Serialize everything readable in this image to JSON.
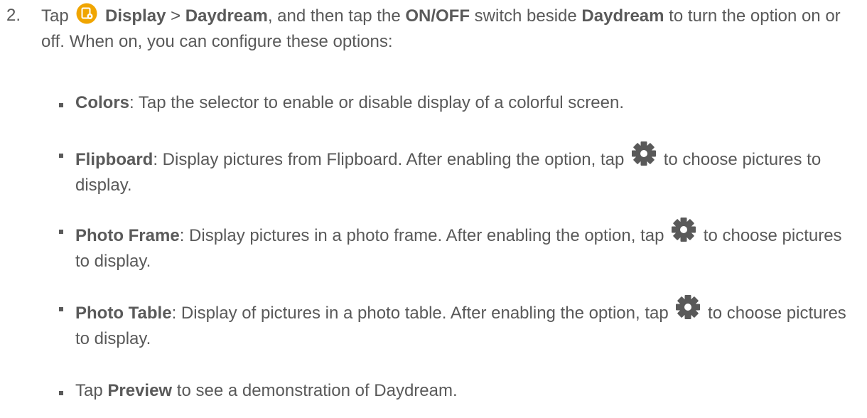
{
  "step": {
    "number": "2.",
    "tap": "Tap",
    "display": "Display",
    "gt": ">",
    "daydream": "Daydream",
    "mid1": ", and then tap the",
    "onoff": "ON/OFF",
    "mid2": "switch beside",
    "daydream2": "Daydream",
    "tail": "to turn the option on or off. When on, you can configure these options:",
    "icon": "settings-app-icon",
    "icon_color": "#F0A500"
  },
  "options": [
    {
      "title": "Colors",
      "text": ": Tap the selector to enable or disable display of a colorful screen."
    },
    {
      "title": "Flipboard",
      "text": ": Display pictures from Flipboard. After enabling the option, tap",
      "icon": "gear-icon",
      "after": "to choose pictures to display."
    },
    {
      "title": "Photo Frame",
      "text": ": Display pictures in a photo frame. After enabling the option, tap",
      "icon": "gear-icon",
      "after": "to choose pictures to display."
    },
    {
      "title": "Photo Table",
      "text": ": Display of pictures in a photo table. After enabling the option, tap",
      "icon": "gear-icon",
      "after": "to choose pictures to display."
    }
  ],
  "preview": {
    "before": "Tap",
    "label": "Preview",
    "after": "to see a demonstration of Daydream."
  }
}
